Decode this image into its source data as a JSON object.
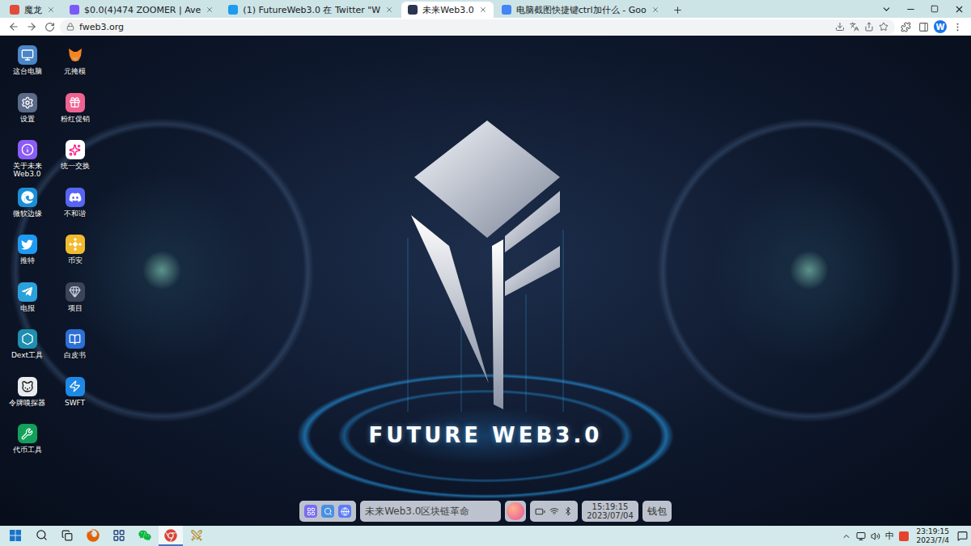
{
  "browser": {
    "tabs": [
      {
        "label": "魔龙",
        "selected": false
      },
      {
        "label": "$0.0(4)474 ZOOMER | Ave",
        "selected": false
      },
      {
        "label": "(1) FutureWeb3.0 在 Twitter \"W",
        "selected": false
      },
      {
        "label": "未来Web3.0",
        "selected": true
      },
      {
        "label": "电脑截图快捷键ctrl加什么 - Goo",
        "selected": false
      }
    ],
    "url": "fweb3.org",
    "profile": "W"
  },
  "desktop": {
    "icons": [
      {
        "label": "这台电脑"
      },
      {
        "label": "设置"
      },
      {
        "label": "关于未来Web3.0"
      },
      {
        "label": "微软边缘"
      },
      {
        "label": "推特"
      },
      {
        "label": "电报"
      },
      {
        "label": "Dext工具"
      },
      {
        "label": "令牌嗅探器"
      },
      {
        "label": "代币工具"
      },
      {
        "label": "元掩模"
      },
      {
        "label": "粉红促销"
      },
      {
        "label": "统一交换"
      },
      {
        "label": "不和谐"
      },
      {
        "label": "币安"
      },
      {
        "label": "项目"
      },
      {
        "label": "白皮书"
      },
      {
        "label": "SWFT"
      }
    ]
  },
  "logo": {
    "title": "FUTURE WEB3.0"
  },
  "dock": {
    "search": "未来Web3.0区块链革命",
    "time": "15:19:15",
    "date": "2023/07/04",
    "wallet": "钱包"
  },
  "taskbar": {
    "apps": [
      {
        "selected": false
      },
      {
        "selected": false
      },
      {
        "selected": false
      },
      {
        "selected": true
      },
      {
        "selected": false
      }
    ],
    "ime": "中",
    "time": "23:19:15",
    "date": "2023/7/4"
  }
}
